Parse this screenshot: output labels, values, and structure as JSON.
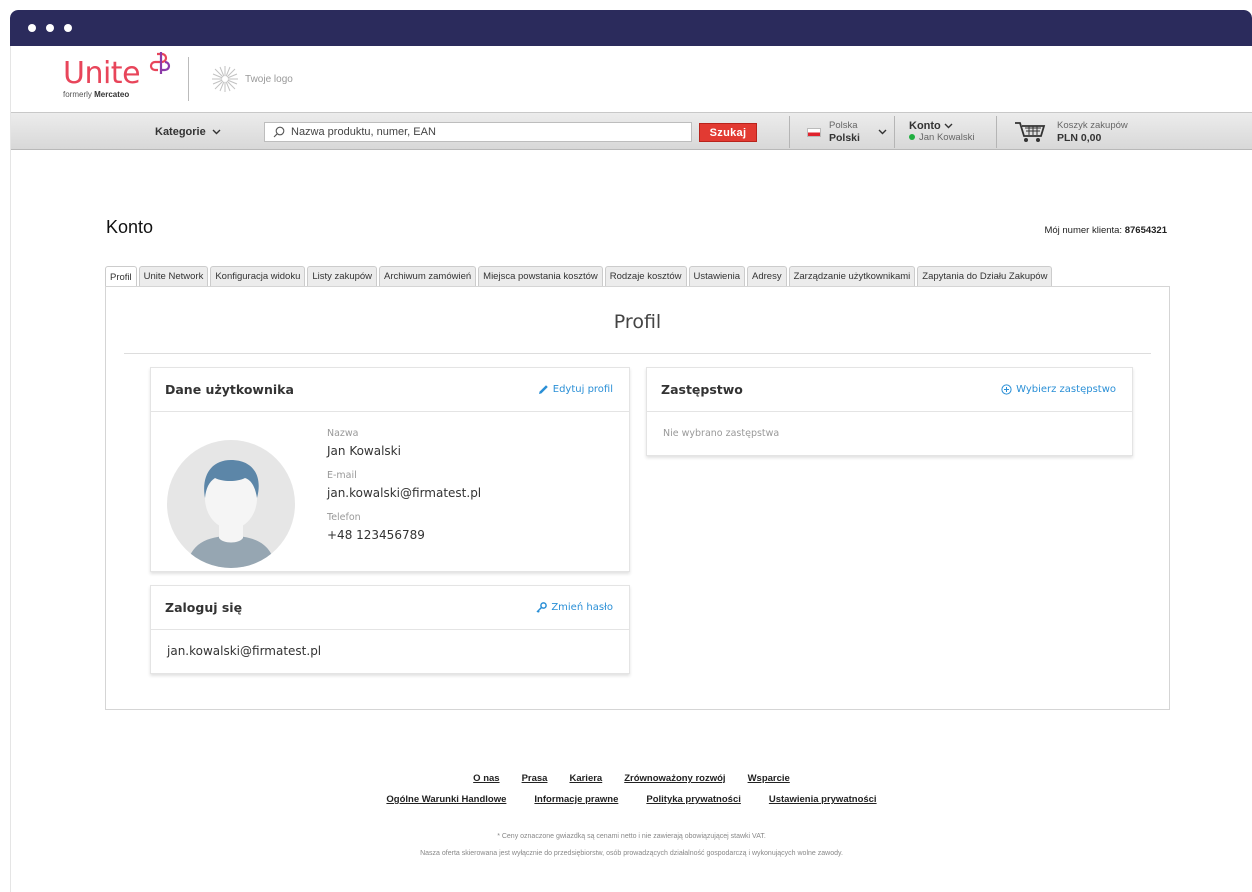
{
  "header": {
    "logo_word": "Unite",
    "logo_formerly": "formerly",
    "logo_brand": "Mercateo",
    "your_logo": "Twoje logo"
  },
  "toolbar": {
    "categories": "Kategorie",
    "search_placeholder": "Nazwa produktu, numer, EAN",
    "search_button": "Szukaj",
    "country": "Polska",
    "language": "Polski",
    "account_label": "Konto",
    "account_user": "Jan Kowalski",
    "cart_label": "Koszyk zakupów",
    "cart_total": "PLN 0,00"
  },
  "page": {
    "title": "Konto",
    "customer_no_label": "Mój numer klienta:",
    "customer_no": "87654321"
  },
  "tabs": [
    "Profil",
    "Unite Network",
    "Konfiguracja widoku",
    "Listy zakupów",
    "Archiwum zamówień",
    "Miejsca powstania kosztów",
    "Rodzaje kosztów",
    "Ustawienia",
    "Adresy",
    "Zarządzanie użytkownikami",
    "Zapytania do Działu Zakupów"
  ],
  "profile": {
    "heading": "Profil",
    "user_card": {
      "title": "Dane użytkownika",
      "edit": "Edytuj profil",
      "name_label": "Nazwa",
      "name": "Jan Kowalski",
      "email_label": "E-mail",
      "email": "jan.kowalski@firmatest.pl",
      "phone_label": "Telefon",
      "phone": "+48 123456789"
    },
    "login_card": {
      "title": "Zaloguj się",
      "change": "Zmień hasło",
      "login": "jan.kowalski@firmatest.pl"
    },
    "deputy_card": {
      "title": "Zastępstwo",
      "choose": "Wybierz zastępstwo",
      "empty": "Nie wybrano zastępstwa"
    }
  },
  "footer": {
    "row1": [
      "O nas",
      "Prasa",
      "Kariera",
      "Zrównoważony rozwój",
      "Wsparcie"
    ],
    "row2": [
      "Ogólne Warunki Handlowe",
      "Informacje prawne",
      "Polityka prywatności",
      "Ustawienia prywatności"
    ],
    "note1": "* Ceny oznaczone gwiazdką są cenami netto i nie zawierają obowiązującej stawki VAT.",
    "note2": "Nasza oferta skierowana jest wyłącznie do przedsiębiorstw, osób prowadzących działalność gospodarczą i wykonujących wolne zawody."
  },
  "colors": {
    "brand": "#e8455a",
    "titlebar": "#2b2b5c",
    "search_button": "#e23a32",
    "link": "#2a8fd6"
  }
}
